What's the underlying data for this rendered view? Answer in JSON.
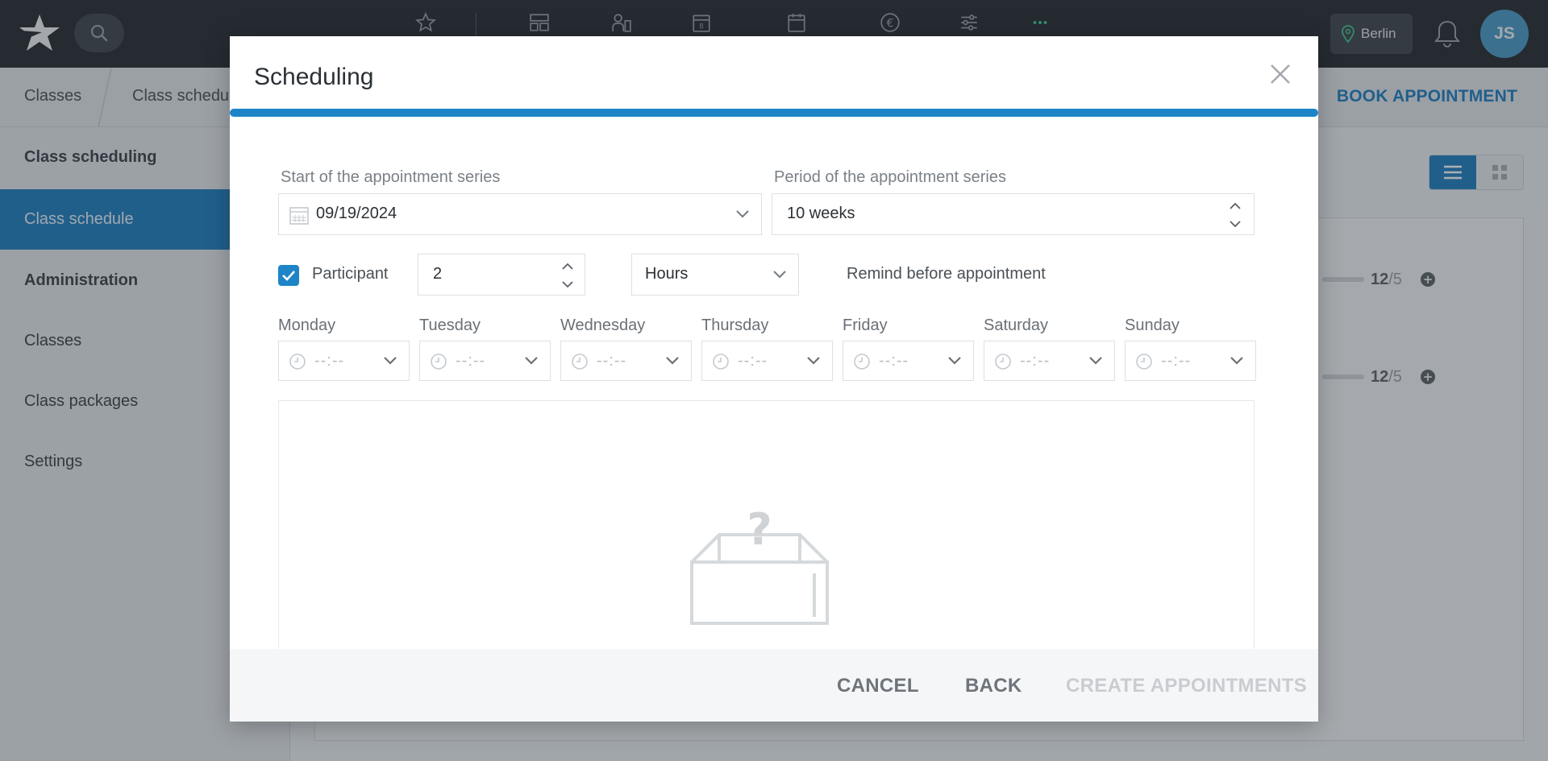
{
  "topbar": {
    "nav_icons": [
      "star-icon",
      "dashboard-icon",
      "staff-icon",
      "calendar-day-icon",
      "calendar-icon",
      "euro-icon",
      "sliders-icon",
      "more-icon"
    ],
    "location": "Berlin",
    "avatar_initials": "JS",
    "accent_color": "#1e84c8"
  },
  "breadcrumb": {
    "items": [
      "Classes",
      "Class schedule"
    ],
    "action": "BOOK APPOINTMENT"
  },
  "sidebar": {
    "sections": [
      {
        "label": "Class scheduling",
        "bold": true
      },
      {
        "label": "Class schedule",
        "active": true
      },
      {
        "label": "Administration",
        "bold": true
      },
      {
        "label": "Classes"
      },
      {
        "label": "Class packages"
      },
      {
        "label": "Settings"
      }
    ]
  },
  "background_rows": [
    {
      "count": "12",
      "max": "/5"
    },
    {
      "count": "12",
      "max": "/5"
    }
  ],
  "modal": {
    "title": "Scheduling",
    "start_label": "Start of the appointment series",
    "start_value": "09/19/2024",
    "period_label": "Period of the appointment series",
    "period_value": "10 weeks",
    "participant_label": "Participant",
    "participant_checked": true,
    "remind_value": "2",
    "remind_unit": "Hours",
    "remind_label": "Remind before appointment",
    "days": [
      {
        "label": "Monday",
        "time": "--:--"
      },
      {
        "label": "Tuesday",
        "time": "--:--"
      },
      {
        "label": "Wednesday",
        "time": "--:--"
      },
      {
        "label": "Thursday",
        "time": "--:--"
      },
      {
        "label": "Friday",
        "time": "--:--"
      },
      {
        "label": "Saturday",
        "time": "--:--"
      },
      {
        "label": "Sunday",
        "time": "--:--"
      }
    ],
    "empty_state_icon": "empty-box-question-icon",
    "footer": {
      "cancel": "CANCEL",
      "back": "BACK",
      "create": "CREATE APPOINTMENTS"
    }
  }
}
